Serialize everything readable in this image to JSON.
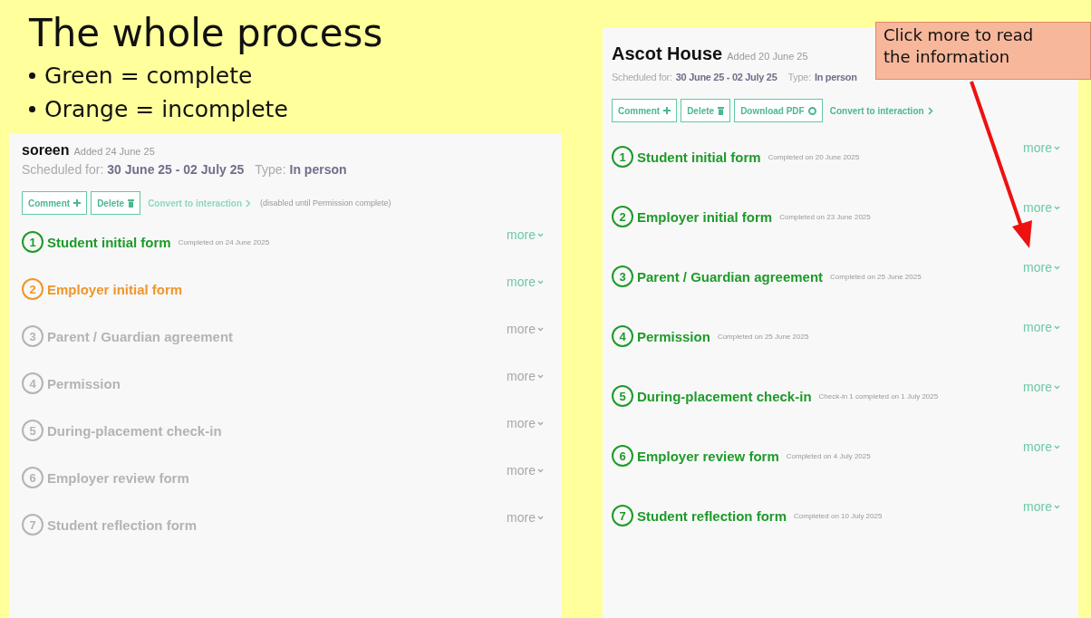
{
  "slide": {
    "title": "The whole process",
    "bullets": [
      "Green = complete",
      "Orange = incomplete"
    ]
  },
  "callout": {
    "text": "Click more to read the information"
  },
  "placements": [
    {
      "name": "soreen",
      "added": "Added 24 June 25",
      "scheduled_label": "Scheduled for:",
      "scheduled": "30 June 25 - 02 July 25",
      "type_label": "Type:",
      "type": "In person",
      "buttons": [
        {
          "kind": "comment",
          "label": "Comment"
        },
        {
          "kind": "delete",
          "label": "Delete"
        }
      ],
      "convert": {
        "label": "Convert to interaction",
        "disabled": true
      },
      "convert_note": "(disabled until Permission complete)",
      "steps": [
        {
          "number": "1",
          "name": "Student initial form",
          "kind": "complete",
          "note": "Completed on 24 June 2025",
          "more": "more"
        },
        {
          "number": "2",
          "name": "Employer initial form",
          "kind": "incomplete",
          "more": "more"
        },
        {
          "number": "3",
          "name": "Parent / Guardian agreement",
          "kind": "locked",
          "more": "more"
        },
        {
          "number": "4",
          "name": "Permission",
          "kind": "locked",
          "more": "more"
        },
        {
          "number": "5",
          "name": "During-placement check-in",
          "kind": "locked",
          "more": "more"
        },
        {
          "number": "6",
          "name": "Employer review form",
          "kind": "locked",
          "more": "more"
        },
        {
          "number": "7",
          "name": "Student reflection form",
          "kind": "locked",
          "more": "more"
        }
      ]
    },
    {
      "name": "Ascot House",
      "added": "Added 20 June 25",
      "scheduled_label": "Scheduled for:",
      "scheduled": "30 June 25 - 02 July 25",
      "type_label": "Type:",
      "type": "In person",
      "buttons": [
        {
          "kind": "comment",
          "label": "Comment"
        },
        {
          "kind": "delete",
          "label": "Delete"
        },
        {
          "kind": "download",
          "label": "Download PDF"
        }
      ],
      "convert": {
        "label": "Convert to interaction",
        "disabled": false
      },
      "steps": [
        {
          "number": "1",
          "name": "Student initial form",
          "kind": "complete",
          "note": "Completed on 20 June 2025",
          "more": "more"
        },
        {
          "number": "2",
          "name": "Employer initial form",
          "kind": "complete",
          "note": "Completed on 23 June 2025",
          "more": "more"
        },
        {
          "number": "3",
          "name": "Parent / Guardian agreement",
          "kind": "complete",
          "note": "Completed on 25 June 2025",
          "more": "more"
        },
        {
          "number": "4",
          "name": "Permission",
          "kind": "complete",
          "note": "Completed on 25 June 2025",
          "more": "more"
        },
        {
          "number": "5",
          "name": "During-placement check-in",
          "kind": "complete",
          "note": "Check-in 1 completed on 1 July 2025",
          "more": "more"
        },
        {
          "number": "6",
          "name": "Employer review form",
          "kind": "complete",
          "note": "Completed on 4 July 2025",
          "more": "more"
        },
        {
          "number": "7",
          "name": "Student reflection form",
          "kind": "complete",
          "note": "Completed on 10 July 2025",
          "more": "more"
        }
      ]
    }
  ]
}
